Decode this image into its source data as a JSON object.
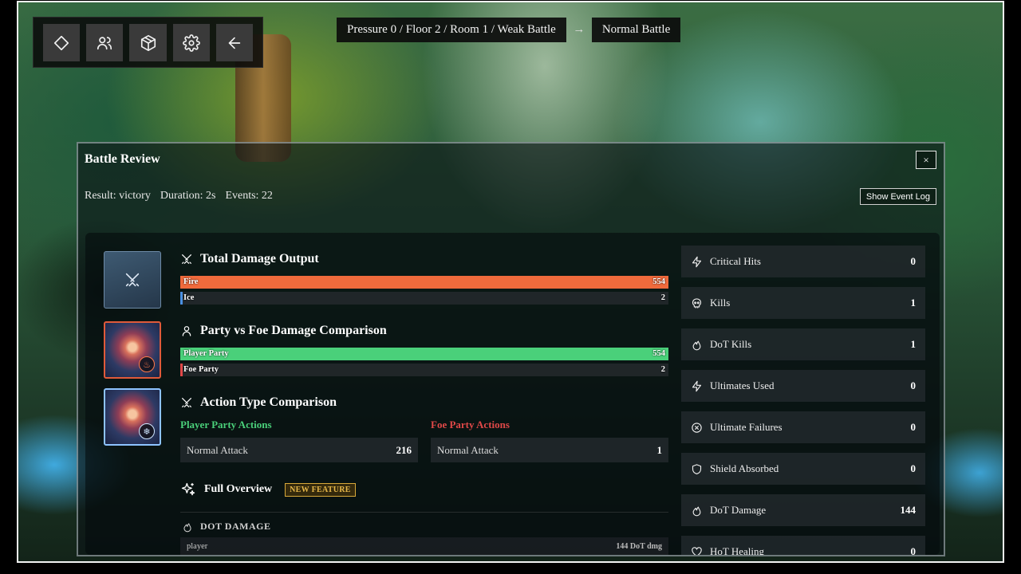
{
  "toolbar": {
    "icons": [
      "diamond-icon",
      "party-icon",
      "inventory-box-icon",
      "settings-gear-icon",
      "back-arrow-icon"
    ]
  },
  "breadcrumb": {
    "location": "Pressure 0 / Floor 2 / Room 1 / Weak Battle",
    "arrow": "→",
    "next": "Normal Battle"
  },
  "modal": {
    "title": "Battle Review",
    "close": "×",
    "result": "Result: victory",
    "duration": "Duration: 2s",
    "events": "Events: 22",
    "event_log_button": "Show Event Log"
  },
  "total_damage": {
    "title": "Total Damage Output",
    "bars": [
      {
        "label": "Fire",
        "value": "554",
        "fraction": 1.0,
        "color": "#f06a3c"
      },
      {
        "label": "Ice",
        "value": "2",
        "fraction": 0.004,
        "color": "#4a90e2"
      }
    ]
  },
  "party_vs_foe": {
    "title": "Party vs Foe Damage Comparison",
    "bars": [
      {
        "label": "Player Party",
        "value": "554",
        "fraction": 1.0,
        "color": "#4ad07a"
      },
      {
        "label": "Foe Party",
        "value": "2",
        "fraction": 0.004,
        "color": "#e04848"
      }
    ]
  },
  "action_type": {
    "title": "Action Type Comparison",
    "player_title": "Player Party Actions",
    "foe_title": "Foe Party Actions",
    "player_color": "#4ad07a",
    "foe_color": "#e04848",
    "player_rows": [
      {
        "label": "Normal Attack",
        "value": "216"
      }
    ],
    "foe_rows": [
      {
        "label": "Normal Attack",
        "value": "1"
      }
    ]
  },
  "overview": {
    "title": "Full Overview",
    "badge": "NEW FEATURE",
    "dot_title": "DOT DAMAGE",
    "dot_row_label": "player",
    "dot_row_value": "144 DoT dmg"
  },
  "stats": [
    {
      "label": "Critical Hits",
      "value": "0",
      "icon": "lightning-icon"
    },
    {
      "label": "Kills",
      "value": "1",
      "icon": "skull-icon"
    },
    {
      "label": "DoT Kills",
      "value": "1",
      "icon": "flame-icon"
    },
    {
      "label": "Ultimates Used",
      "value": "0",
      "icon": "lightning-icon"
    },
    {
      "label": "Ultimate Failures",
      "value": "0",
      "icon": "x-circle-icon"
    },
    {
      "label": "Shield Absorbed",
      "value": "0",
      "icon": "shield-icon"
    },
    {
      "label": "DoT Damage",
      "value": "144",
      "icon": "flame-icon"
    },
    {
      "label": "HoT Healing",
      "value": "0",
      "icon": "heart-icon"
    }
  ]
}
